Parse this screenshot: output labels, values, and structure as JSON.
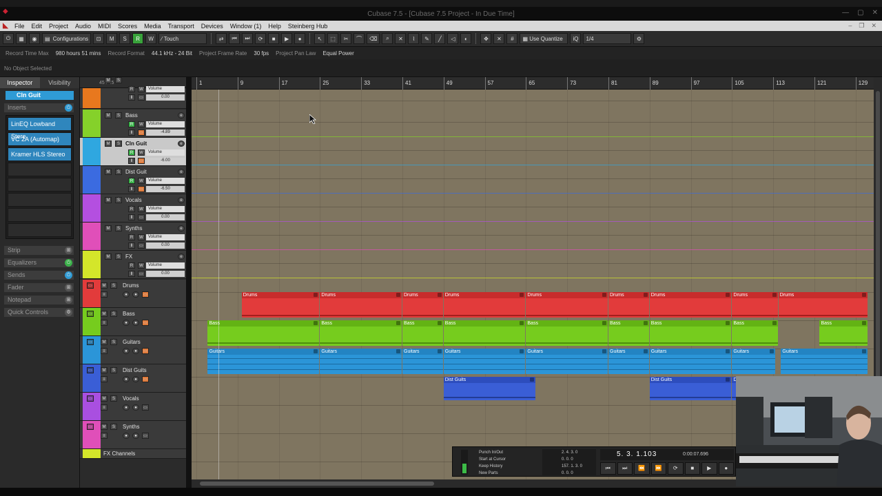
{
  "window": {
    "title": "Cubase 7.5 - [Cubase 7.5 Project - In Due Time]"
  },
  "menu": [
    "File",
    "Edit",
    "Project",
    "Audio",
    "MIDI",
    "Scores",
    "Media",
    "Transport",
    "Devices",
    "Window (1)",
    "Help",
    "Steinberg Hub"
  ],
  "toolbar": {
    "configurations": "Configurations",
    "automation_mode": "Touch",
    "quantize_mode": "Use Quantize",
    "quantize_value": "1/4",
    "mode_buttons": [
      "M",
      "S",
      "R",
      "W"
    ]
  },
  "infoline": {
    "record_time_max_label": "Record Time Max",
    "record_time_max_value": "980 hours 51 mins",
    "record_format_label": "Record Format",
    "record_format_value": "44.1 kHz - 24 Bit",
    "frame_rate_label": "Project Frame Rate",
    "frame_rate_value": "30 fps",
    "pan_law_label": "Project Pan Law",
    "pan_law_value": "Equal Power"
  },
  "status": "No Object Selected",
  "inspector": {
    "tabs": [
      "Inspector",
      "Visibility"
    ],
    "track_name": "Cln Guit",
    "inserts_label": "Inserts",
    "inserts": [
      "LinEQ Lowband Stere",
      "VC 2A (Automap)",
      "Kramer HLS Stereo"
    ],
    "sections": [
      "Strip",
      "Equalizers",
      "Sends",
      "Fader",
      "Notepad",
      "Quick Controls"
    ]
  },
  "tracklist": {
    "count": "45 / 45",
    "group_tracks": [
      {
        "name": "",
        "color": "#e8781e",
        "volume_label": "Volume",
        "volume": "0.00"
      },
      {
        "name": "Bass",
        "color": "#85d12a",
        "volume_label": "Volume",
        "volume": "-4.89"
      },
      {
        "name": "Cln Guit",
        "color": "#2fa7e0",
        "volume_label": "Volume",
        "volume": "-6.00"
      },
      {
        "name": "Dist Guit",
        "color": "#3b6be0",
        "volume_label": "Volume",
        "volume": "-6.50"
      },
      {
        "name": "Vocals",
        "color": "#b44fe0",
        "volume_label": "Volume",
        "volume": "0.00"
      },
      {
        "name": "Synths",
        "color": "#e04fb9",
        "volume_label": "Volume",
        "volume": "0.00"
      },
      {
        "name": "FX",
        "color": "#d4e62a",
        "volume_label": "Volume",
        "volume": "0.00"
      }
    ],
    "folder_tracks": [
      {
        "name": "Drums",
        "color": "#e23b3b"
      },
      {
        "name": "Bass",
        "color": "#76cc1e"
      },
      {
        "name": "Guitars",
        "color": "#2b95d8"
      },
      {
        "name": "Dist Guits",
        "color": "#3a5ed6"
      },
      {
        "name": "Vocals",
        "color": "#a94fe0"
      },
      {
        "name": "Synths",
        "color": "#e04fb9"
      }
    ],
    "fx_channels_label": "FX Channels"
  },
  "ruler": [
    "1",
    "9",
    "17",
    "25",
    "33",
    "41",
    "49",
    "57",
    "65",
    "73",
    "81",
    "89",
    "97",
    "105",
    "113",
    "121",
    "129"
  ],
  "parts": {
    "drums": "Drums",
    "bass": "Bass",
    "guitars": "Guitars",
    "dist": "Dist Guits"
  },
  "transport": {
    "options": [
      "Punch In/Out",
      "Start at Cursor",
      "Keep History",
      "New Parts"
    ],
    "left_locator": "2. 4. 3.   0",
    "left_zero": "0.   0.   0",
    "right_locator": "157. 1. 3.   0",
    "right_zero": "0.   0.   0",
    "position": "5. 3. 1.103",
    "time": "0:00:07.696"
  }
}
